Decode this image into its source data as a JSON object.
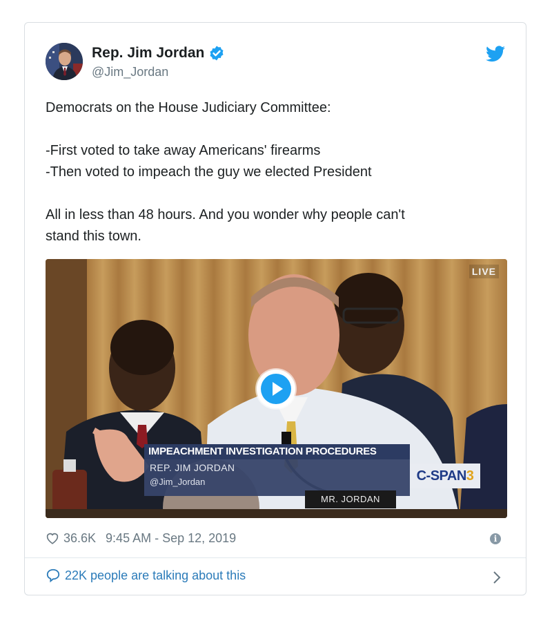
{
  "author": {
    "name": "Rep. Jim Jordan",
    "handle": "@Jim_Jordan",
    "verified": true
  },
  "tweet": {
    "lines": [
      "Democrats on the House Judiciary Committee:",
      "",
      "-First voted to take away Americans' firearms",
      "-Then voted to impeach the guy we elected President",
      "",
      "All in less than 48 hours. And you wonder why people can't",
      "stand this town."
    ]
  },
  "media": {
    "live_label": "LIVE",
    "chyron_title": "IMPEACHMENT INVESTIGATION PROCEDURES",
    "chyron_name": "REP. JIM JORDAN",
    "chyron_handle": "@Jim_Jordan",
    "network_logo": "C-SPAN",
    "network_logo_number": "3",
    "nameplate": "MR. JORDAN"
  },
  "meta": {
    "likes": "36.6K",
    "timestamp": "9:45 AM - Sep 12, 2019"
  },
  "footer": {
    "talking_label": "22K people are talking about this"
  },
  "colors": {
    "brand_blue": "#1da1f2",
    "link_blue": "#2b7bb9",
    "muted": "#697882",
    "chyron_navy": "#2c3b62"
  },
  "icons": [
    "twitter-bird-icon",
    "verified-badge-icon",
    "play-icon",
    "heart-icon",
    "info-icon",
    "comment-bubble-icon",
    "chevron-right-icon"
  ]
}
